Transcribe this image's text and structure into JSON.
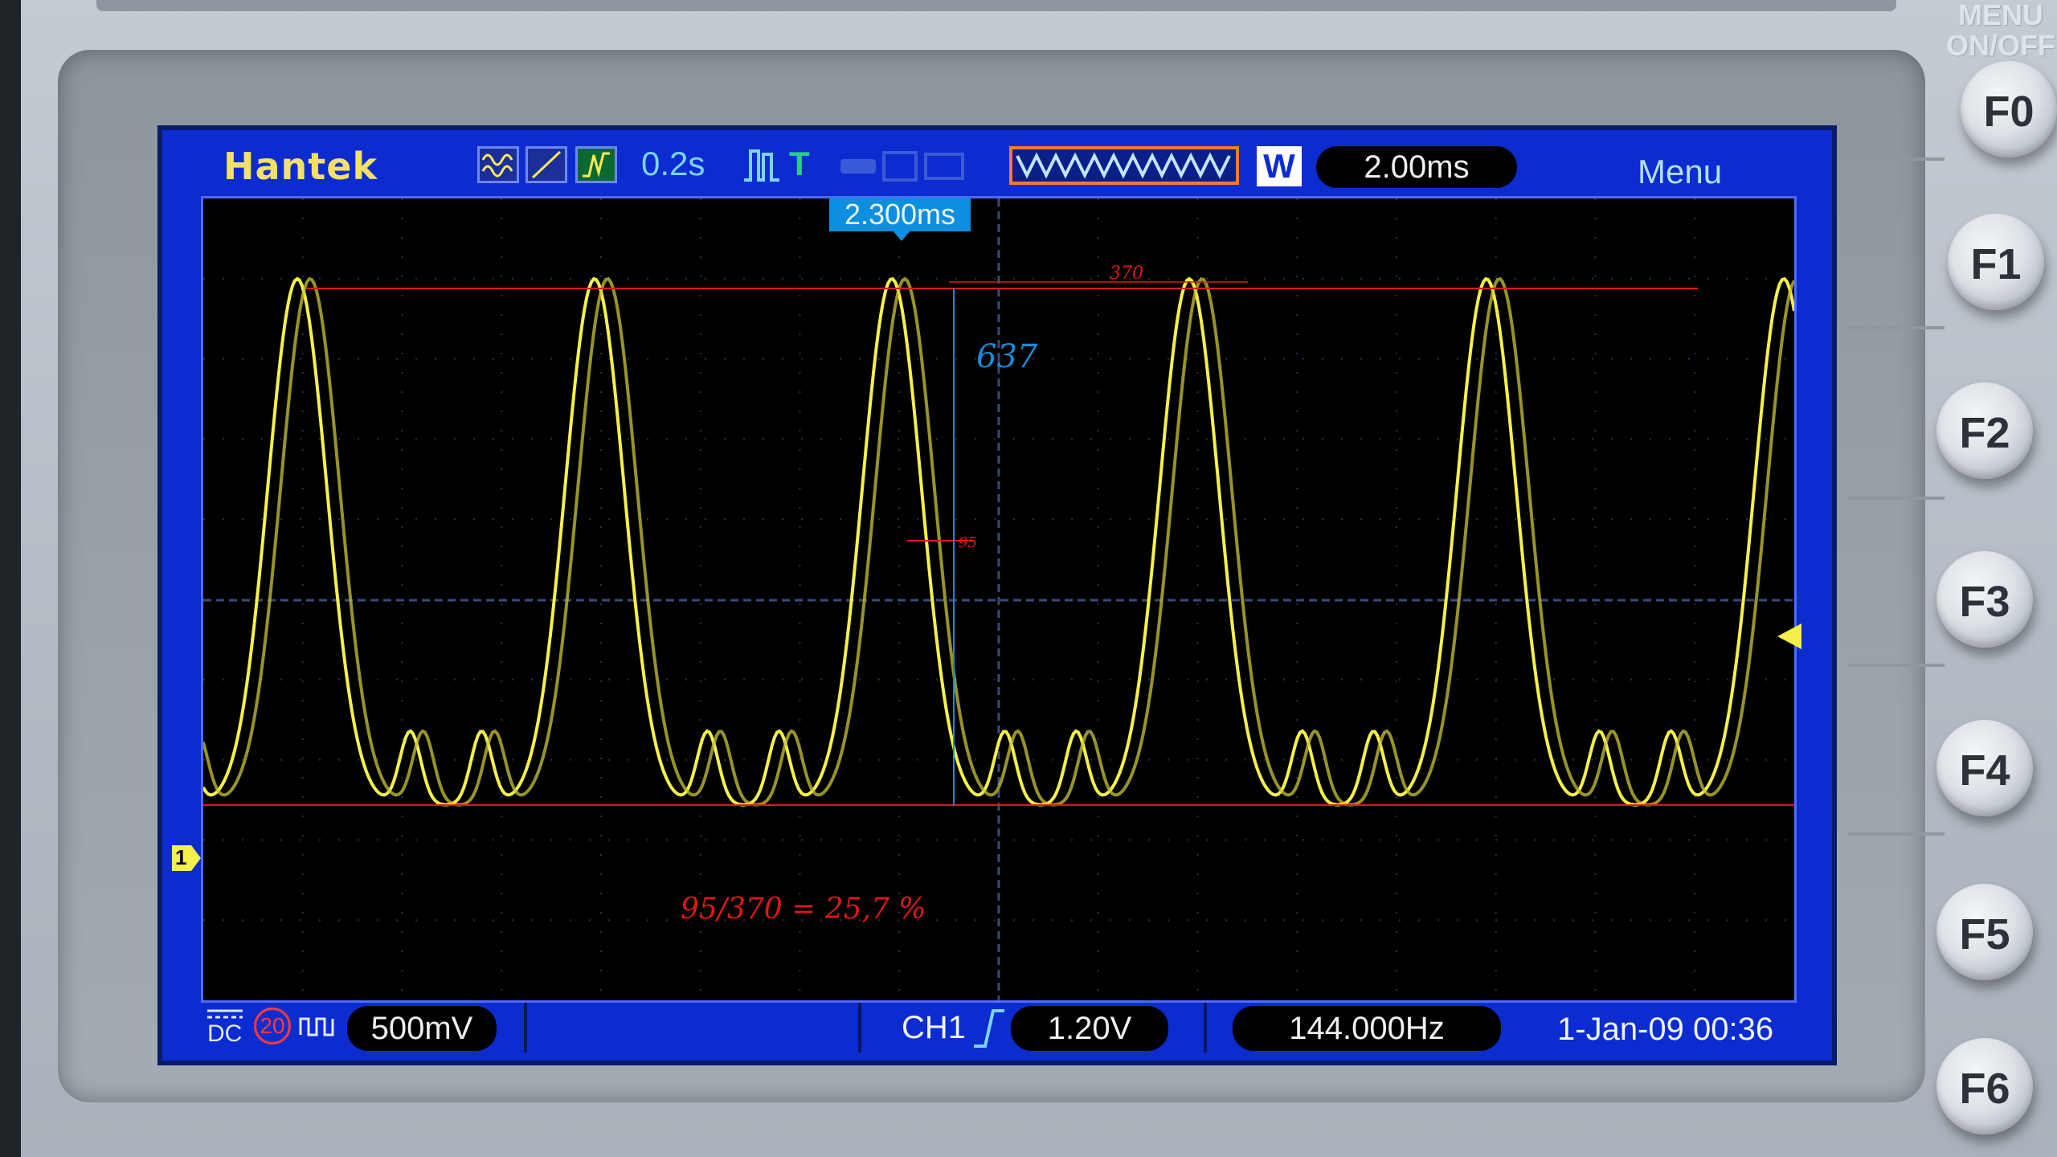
{
  "device": {
    "brand": "Hantek",
    "corner_label": "MENU\nON/OFF"
  },
  "header": {
    "timebase_shift": "0.2s",
    "trigger_mode_letter": "T",
    "window_badge": "W",
    "time_div": "2.00ms",
    "menu_label": "Menu",
    "trigger_position": "2.300ms"
  },
  "footer": {
    "coupling": "DC",
    "bw_limit": "20",
    "volts_div": "500mV",
    "trigger_channel": "CH1",
    "trigger_level": "1.20V",
    "frequency": "144.000Hz",
    "datetime": "1-Jan-09 00:36"
  },
  "annotations": {
    "peak_value": "370",
    "delta_value": "637",
    "ripple_value": "95",
    "ratio_text": "95/370 = 25,7 %"
  },
  "markers": {
    "channel_marker": "1"
  },
  "buttons": [
    "F0",
    "F1",
    "F2",
    "F3",
    "F4",
    "F5",
    "F6"
  ],
  "colors": {
    "screen_bg": "#0c2cd0",
    "trace": "#f4f04a",
    "annotation_red": "#e01818",
    "annotation_blue": "#1a8bd8"
  }
}
